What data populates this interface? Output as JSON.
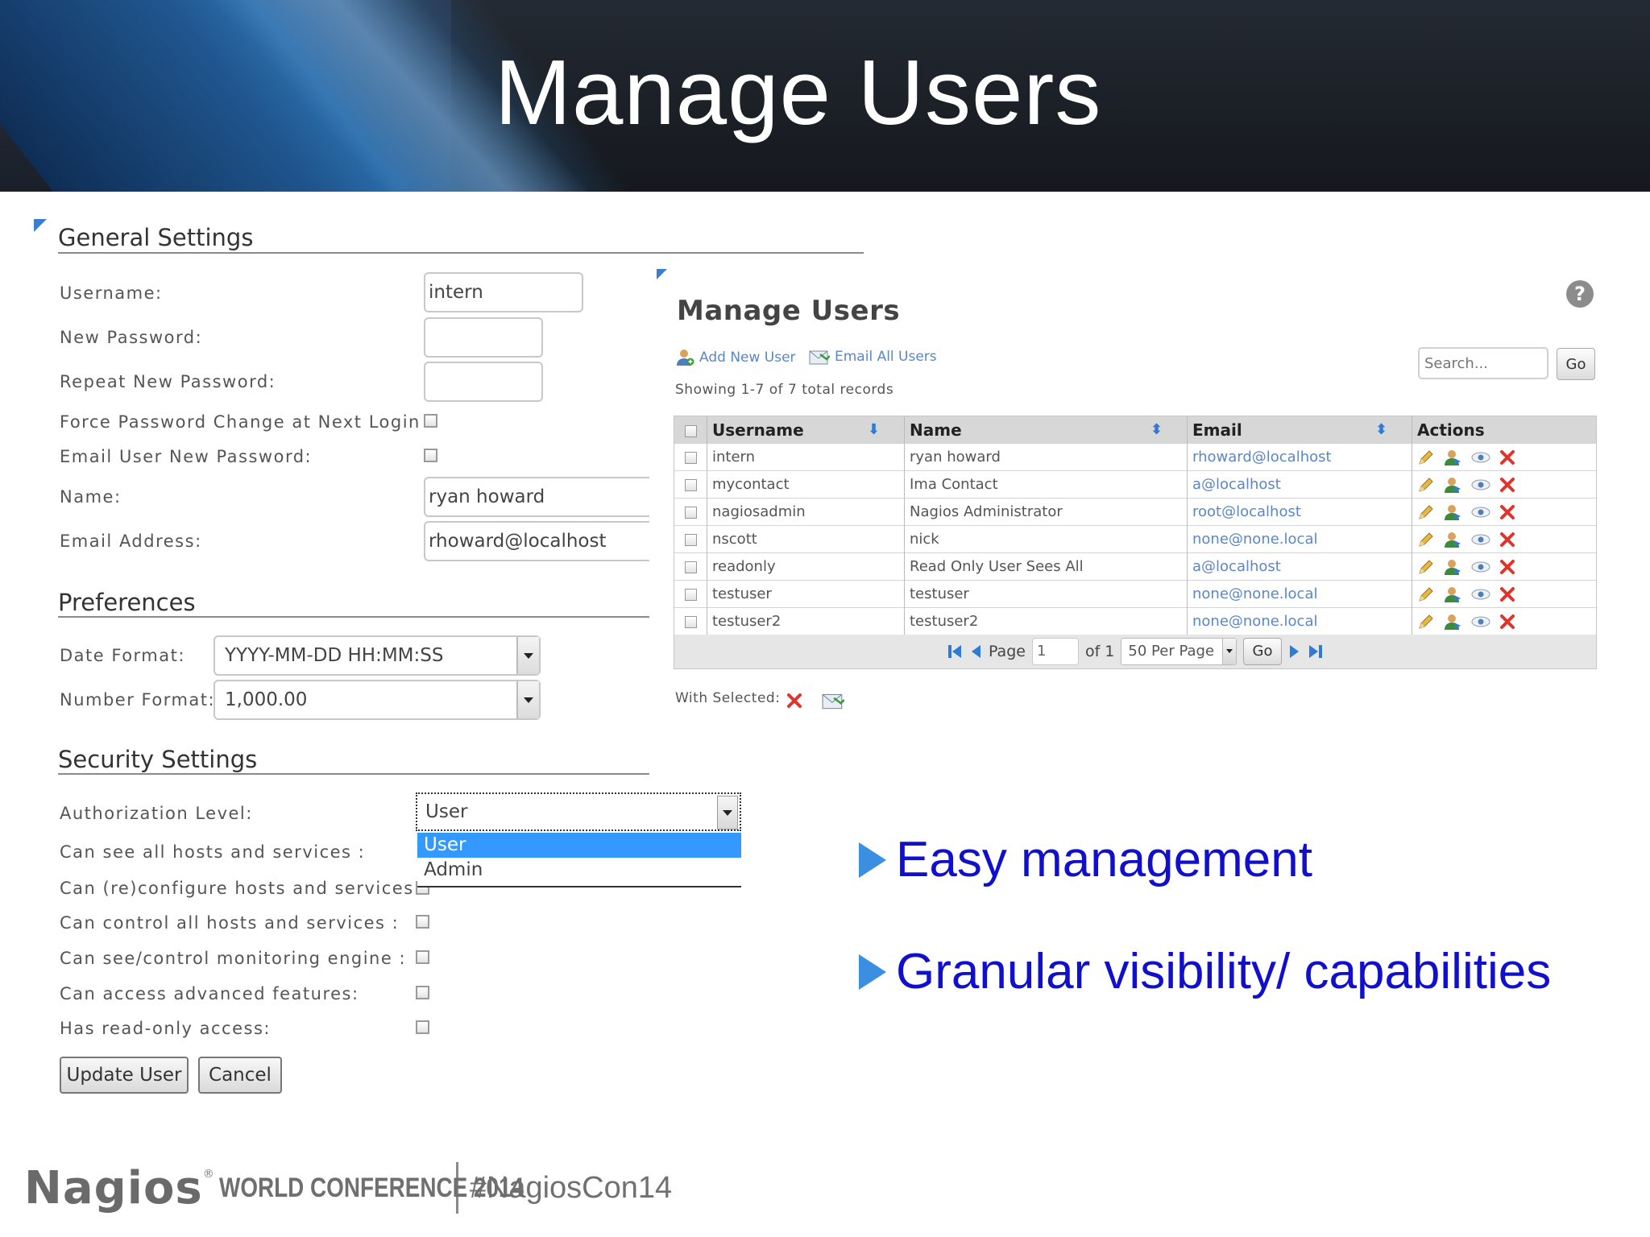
{
  "slide": {
    "title": "Manage Users"
  },
  "general": {
    "title": "General Settings",
    "username_label": "Username:",
    "username_value": "intern",
    "new_password_label": "New Password:",
    "repeat_password_label": "Repeat New Password:",
    "force_change_label": "Force Password Change at Next Login :",
    "email_user_label": "Email User New Password:",
    "name_label": "Name:",
    "name_value": "ryan howard",
    "email_label": "Email Address:",
    "email_value": "rhoward@localhost"
  },
  "preferences": {
    "title": "Preferences",
    "date_format_label": "Date Format:",
    "date_format_value": "YYYY-MM-DD HH:MM:SS",
    "number_format_label": "Number Format:",
    "number_format_value": "1,000.00"
  },
  "security": {
    "title": "Security Settings",
    "auth_label": "Authorization Level:",
    "auth_value": "User",
    "auth_options": [
      "User",
      "Admin"
    ],
    "perm1": "Can see all hosts and services :",
    "perm2": "Can (re)configure hosts and services :",
    "perm3": "Can control all hosts and services :",
    "perm4": "Can see/control monitoring engine :",
    "perm5": "Can access advanced features:",
    "perm6": "Has read-only access:"
  },
  "buttons": {
    "update": "Update User",
    "cancel": "Cancel"
  },
  "manage": {
    "title": "Manage Users",
    "help": "?",
    "add_user": "Add New User",
    "email_all": "Email All Users",
    "showing": "Showing 1-7 of 7 total records",
    "search_placeholder": "Search...",
    "go": "Go",
    "columns": [
      "Username",
      "Name",
      "Email",
      "Actions"
    ],
    "rows": [
      [
        "intern",
        "ryan howard",
        "rhoward@localhost"
      ],
      [
        "mycontact",
        "Ima Contact",
        "a@localhost"
      ],
      [
        "nagiosadmin",
        "Nagios Administrator",
        "root@localhost"
      ],
      [
        "nscott",
        "nick",
        "none@none.local"
      ],
      [
        "readonly",
        "Read Only User Sees All",
        "a@localhost"
      ],
      [
        "testuser",
        "testuser",
        "none@none.local"
      ],
      [
        "testuser2",
        "testuser2",
        "none@none.local"
      ]
    ],
    "pager": {
      "page_label": "Page",
      "page_value": "1",
      "of": "of 1",
      "per_page": "50 Per Page",
      "go": "Go"
    },
    "with_selected": "With Selected:"
  },
  "bullets": [
    "Easy management",
    "Granular visibility/ capabilities"
  ],
  "footer": {
    "brand": "Nagios",
    "reg": "®",
    "conference": "WORLD CONFERENCE 2014",
    "hashtag": "#NagiosCon14"
  },
  "colors": {
    "accent_blue": "#1010cc",
    "link_blue": "#5a87c5",
    "delete_red": "#e0342a"
  }
}
